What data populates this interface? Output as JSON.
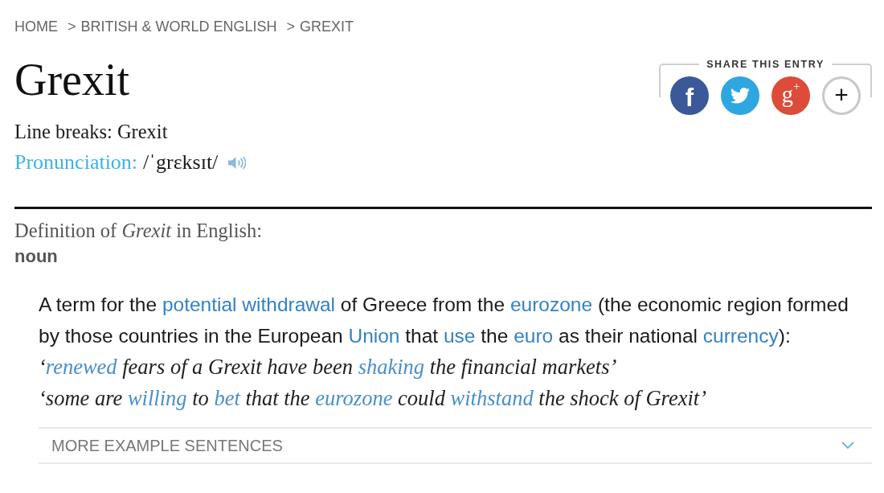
{
  "breadcrumb": {
    "separator": ">",
    "items": [
      "HOME",
      "BRITISH & WORLD ENGLISH",
      "GREXIT"
    ]
  },
  "entry": {
    "headword": "Grexit",
    "line_breaks": "Line breaks: Grexit",
    "pronunciation": {
      "label": "Pronunciation:",
      "text": "/ˈgrɛksɪt/"
    }
  },
  "share": {
    "title": "SHARE THIS ENTRY",
    "buttons": [
      {
        "kind": "glyph",
        "label": "f",
        "color": "#3b5998"
      },
      {
        "kind": "bird",
        "color": "#2ea7e0"
      },
      {
        "kind": "glyph",
        "label": "g$^{+}$",
        "color": "#dd4b39"
      },
      {
        "kind": "outline",
        "label": "+"
      }
    ]
  },
  "definition": {
    "heading": "Definition of *Grexit* in English:",
    "part_of_speech": "noun",
    "sense": [
      {
        "text": "A term for the ",
        "link": false
      },
      {
        "text": "potential withdrawal",
        "link": true
      },
      {
        "text": " of Greece from the ",
        "link": false
      },
      {
        "text": "eurozone",
        "link": true
      },
      {
        "text": " (the economic region formed by those countries in the European ",
        "link": false
      },
      {
        "text": "Union",
        "link": true
      },
      {
        "text": " that ",
        "link": false
      },
      {
        "text": "use",
        "link": true
      },
      {
        "text": " the ",
        "link": false
      },
      {
        "text": "euro",
        "link": true
      },
      {
        "text": " as their national ",
        "link": false
      },
      {
        "text": "currency",
        "link": true
      },
      {
        "text": "):",
        "link": false
      }
    ],
    "examples": [
      [
        {
          "text": "‘",
          "link": false
        },
        {
          "text": "renewed",
          "link": true
        },
        {
          "text": " fears of a Grexit have been ",
          "link": false
        },
        {
          "text": "shaking",
          "link": true
        },
        {
          "text": " the financial markets’",
          "link": false
        }
      ],
      [
        {
          "text": "‘some are ",
          "link": false
        },
        {
          "text": "willing",
          "link": true
        },
        {
          "text": " to ",
          "link": false
        },
        {
          "text": "bet",
          "link": true
        },
        {
          "text": " that the ",
          "link": false
        },
        {
          "text": "eurozone",
          "link": true
        },
        {
          "text": " could ",
          "link": false
        },
        {
          "text": "withstand",
          "link": true
        },
        {
          "text": " the shock of Grexit’",
          "link": false
        }
      ]
    ],
    "more_examples": {
      "label": "MORE EXAMPLE SENTENCES",
      "expanded": false
    }
  }
}
